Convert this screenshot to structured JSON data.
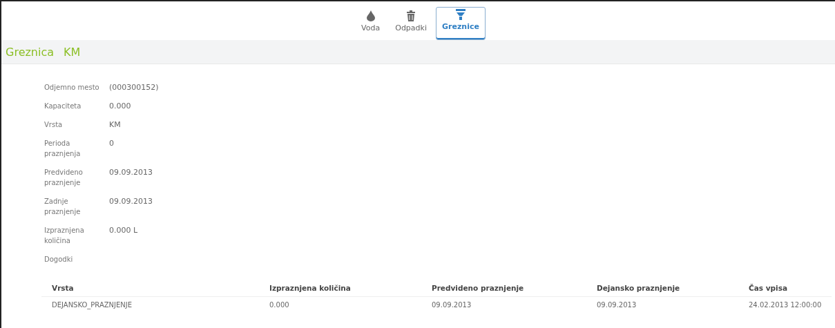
{
  "tabs": [
    {
      "label": "Voda",
      "kind": "drop",
      "selected": false
    },
    {
      "label": "Odpadki",
      "kind": "bin",
      "selected": false
    },
    {
      "label": "Greznice",
      "kind": "funnel",
      "selected": true
    }
  ],
  "title": {
    "name": "Greznica",
    "type": "KM"
  },
  "fields": [
    {
      "label": "Odjemno mesto",
      "value": "(000300152)"
    },
    {
      "label": "Kapaciteta",
      "value": "0.000"
    },
    {
      "label": "Vrsta",
      "value": "KM"
    },
    {
      "label": "Perioda praznjenja",
      "value": "0"
    },
    {
      "label": "Predvideno praznjenje",
      "value": "09.09.2013"
    },
    {
      "label": "Zadnje praznjenje",
      "value": "09.09.2013"
    },
    {
      "label": "Izpraznjena količina",
      "value": "0.000 L"
    },
    {
      "label": "Dogodki"
    }
  ],
  "table": {
    "columns": [
      "Vrsta",
      "Izpraznjena količina",
      "Predvideno praznjenje",
      "Dejansko praznjenje",
      "Čas vpisa"
    ],
    "rows": [
      [
        "DEJANSKO_PRAZNJENJE",
        "0.000",
        "09.09.2013",
        "09.09.2013",
        "24.02.2013 12:00:00"
      ]
    ]
  }
}
